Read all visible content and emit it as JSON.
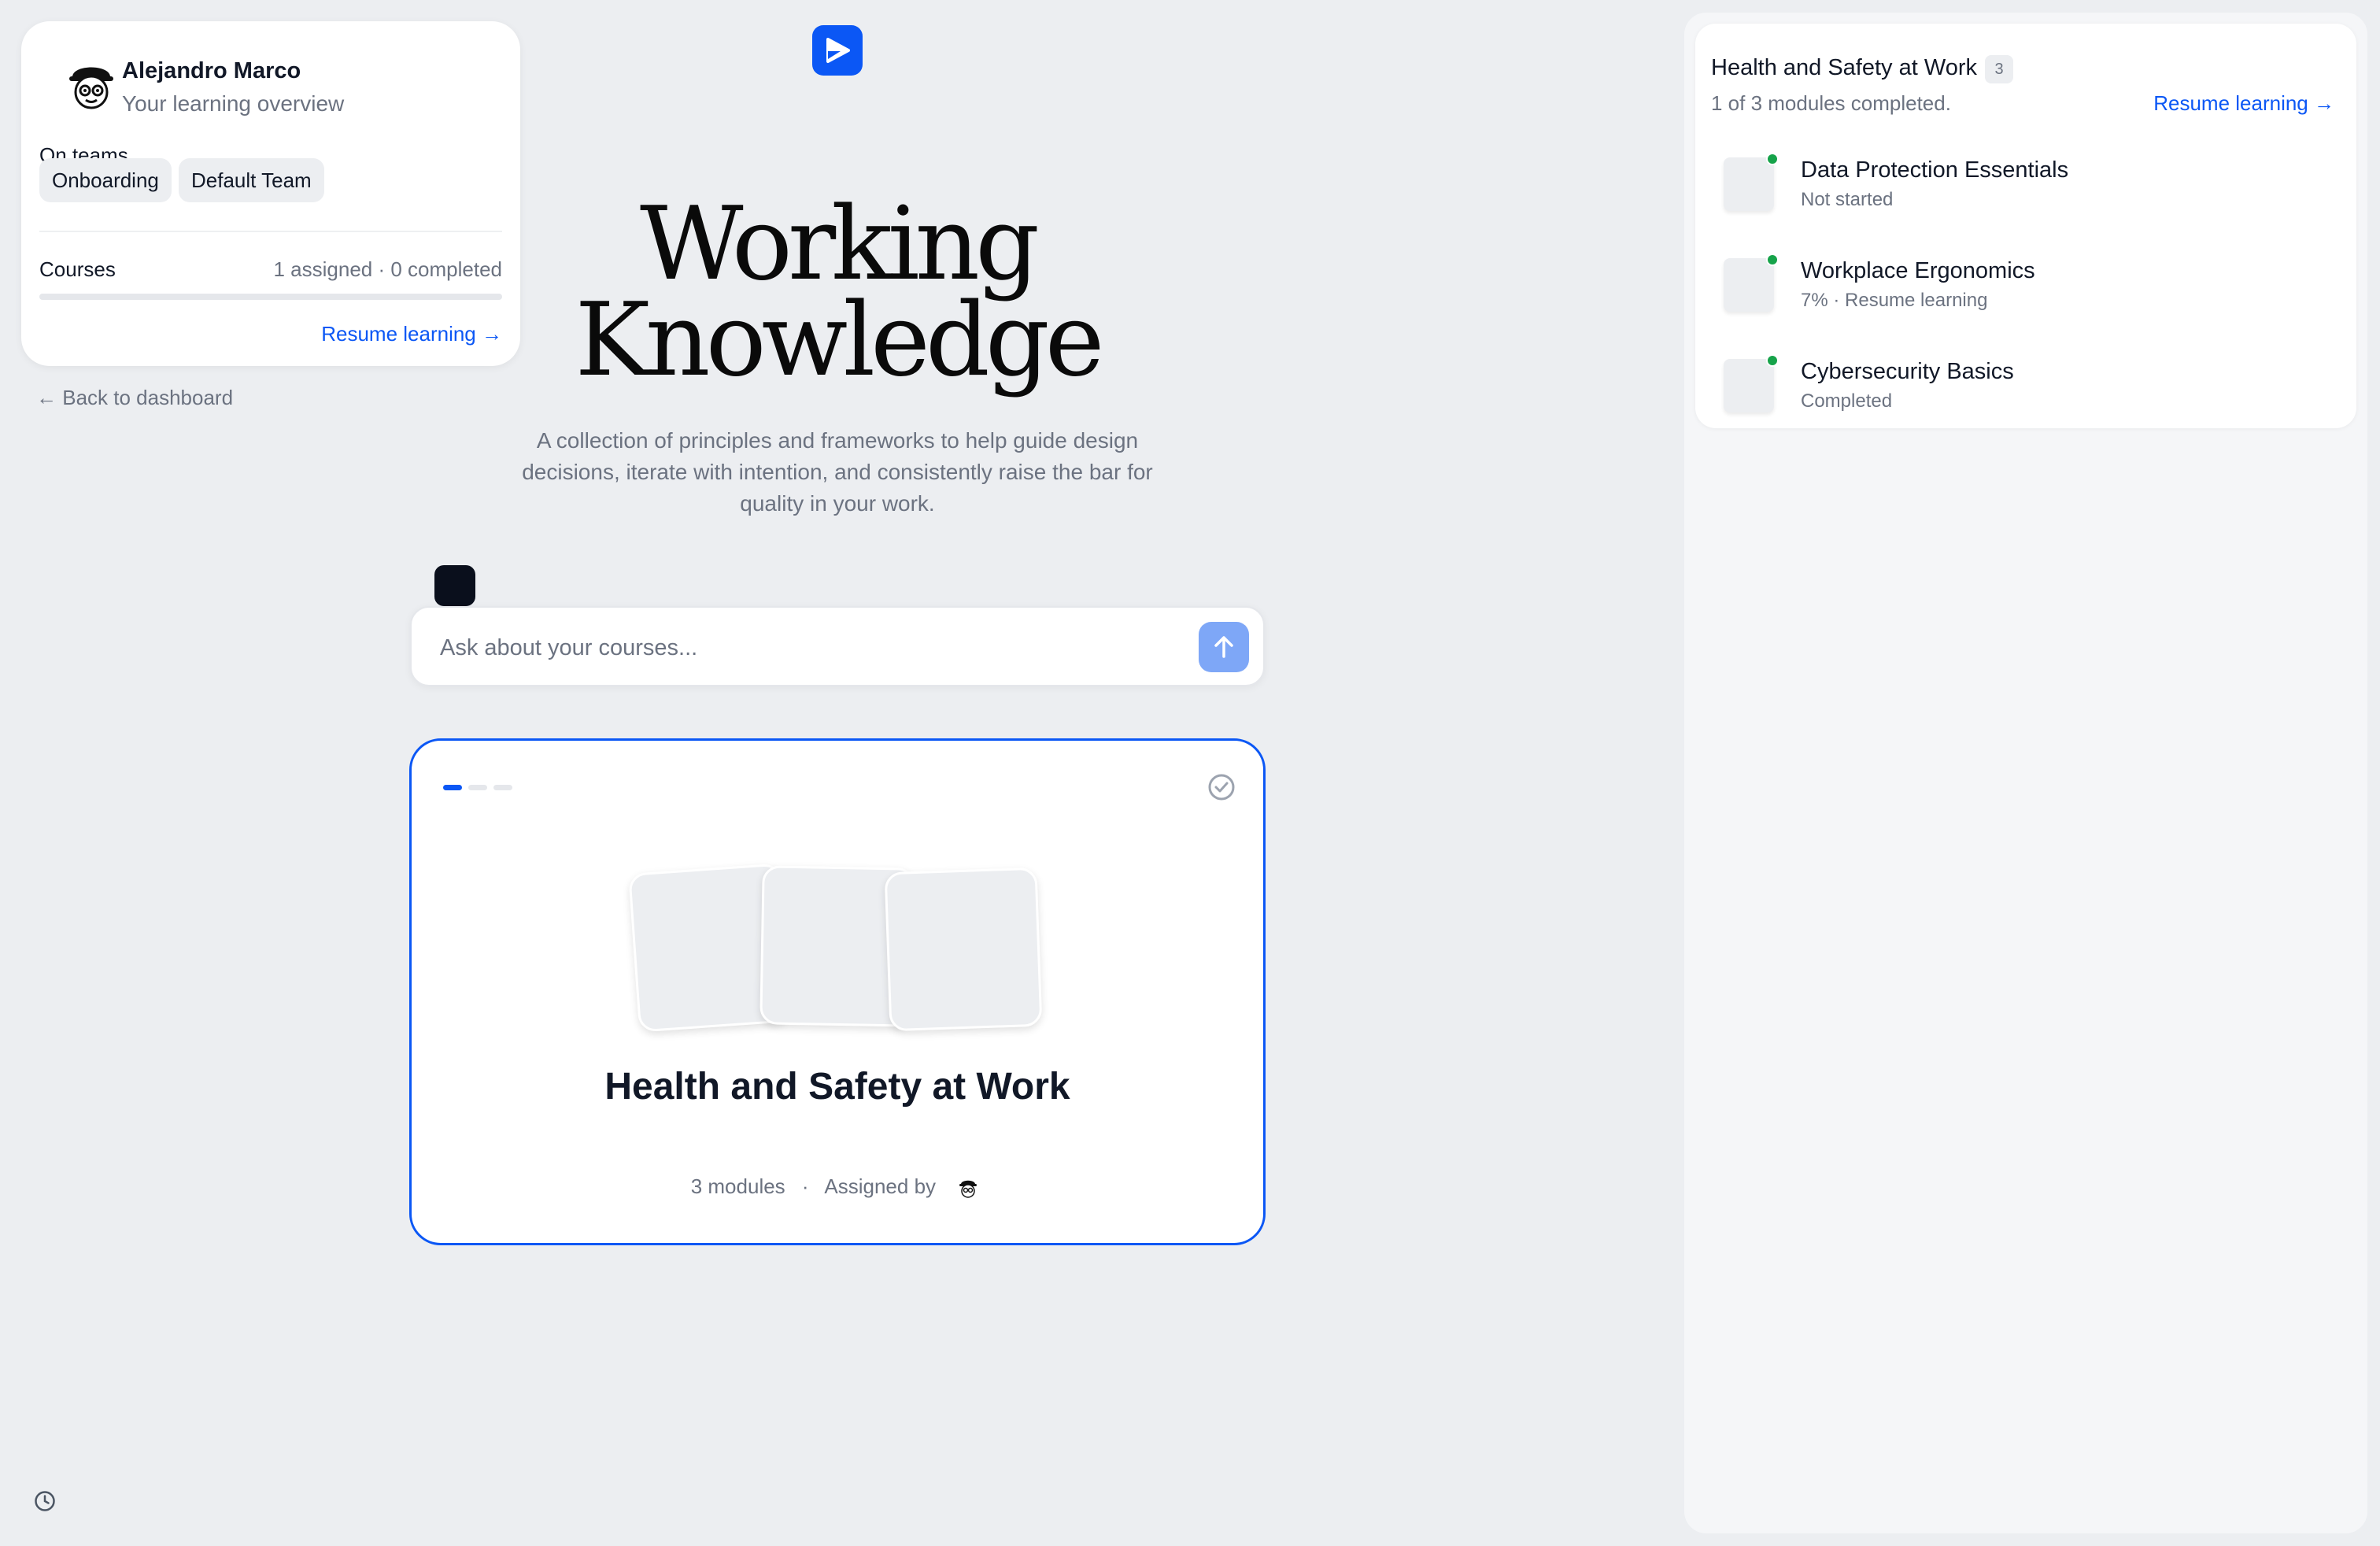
{
  "profile": {
    "name": "Alejandro Marco",
    "subtitle": "Your learning overview",
    "teams_label": "On teams",
    "teams": [
      "Onboarding",
      "Default Team"
    ],
    "courses_label": "Courses",
    "courses_stats": "1 assigned · 0 completed",
    "courses_progress": 0,
    "resume_label": "Resume learning →"
  },
  "nav": {
    "back_label": "← Back to dashboard"
  },
  "hero": {
    "title_line1": "Working",
    "title_line2": "Knowledge",
    "description": "A collection of principles and frameworks to help guide design decisions, iterate with intention, and consistently raise the bar for quality in your work."
  },
  "ask": {
    "placeholder": "Ask about your courses..."
  },
  "course_card": {
    "title": "Health and Safety at Work",
    "modules_label": "3 modules",
    "separator": "·",
    "assigned_by_label": "Assigned by"
  },
  "side_panel": {
    "title": "Health and Safety at Work",
    "count": "3",
    "progress_text": "1 of 3 modules completed.",
    "resume_label": "Resume learning →",
    "modules": [
      {
        "title": "Data Protection Essentials",
        "status": "Not started"
      },
      {
        "title": "Workplace Ergonomics",
        "status": "7% · Resume learning"
      },
      {
        "title": "Cybersecurity Basics",
        "status": "Completed"
      }
    ]
  },
  "colors": {
    "accent": "#0b57f5",
    "status_dot": "#16a34a",
    "background": "#eceef1"
  },
  "icons": [
    "avatar-icon",
    "play-logo-icon",
    "send-arrow-icon",
    "check-circle-icon",
    "clock-icon",
    "arrow-right-icon",
    "arrow-left-icon"
  ]
}
